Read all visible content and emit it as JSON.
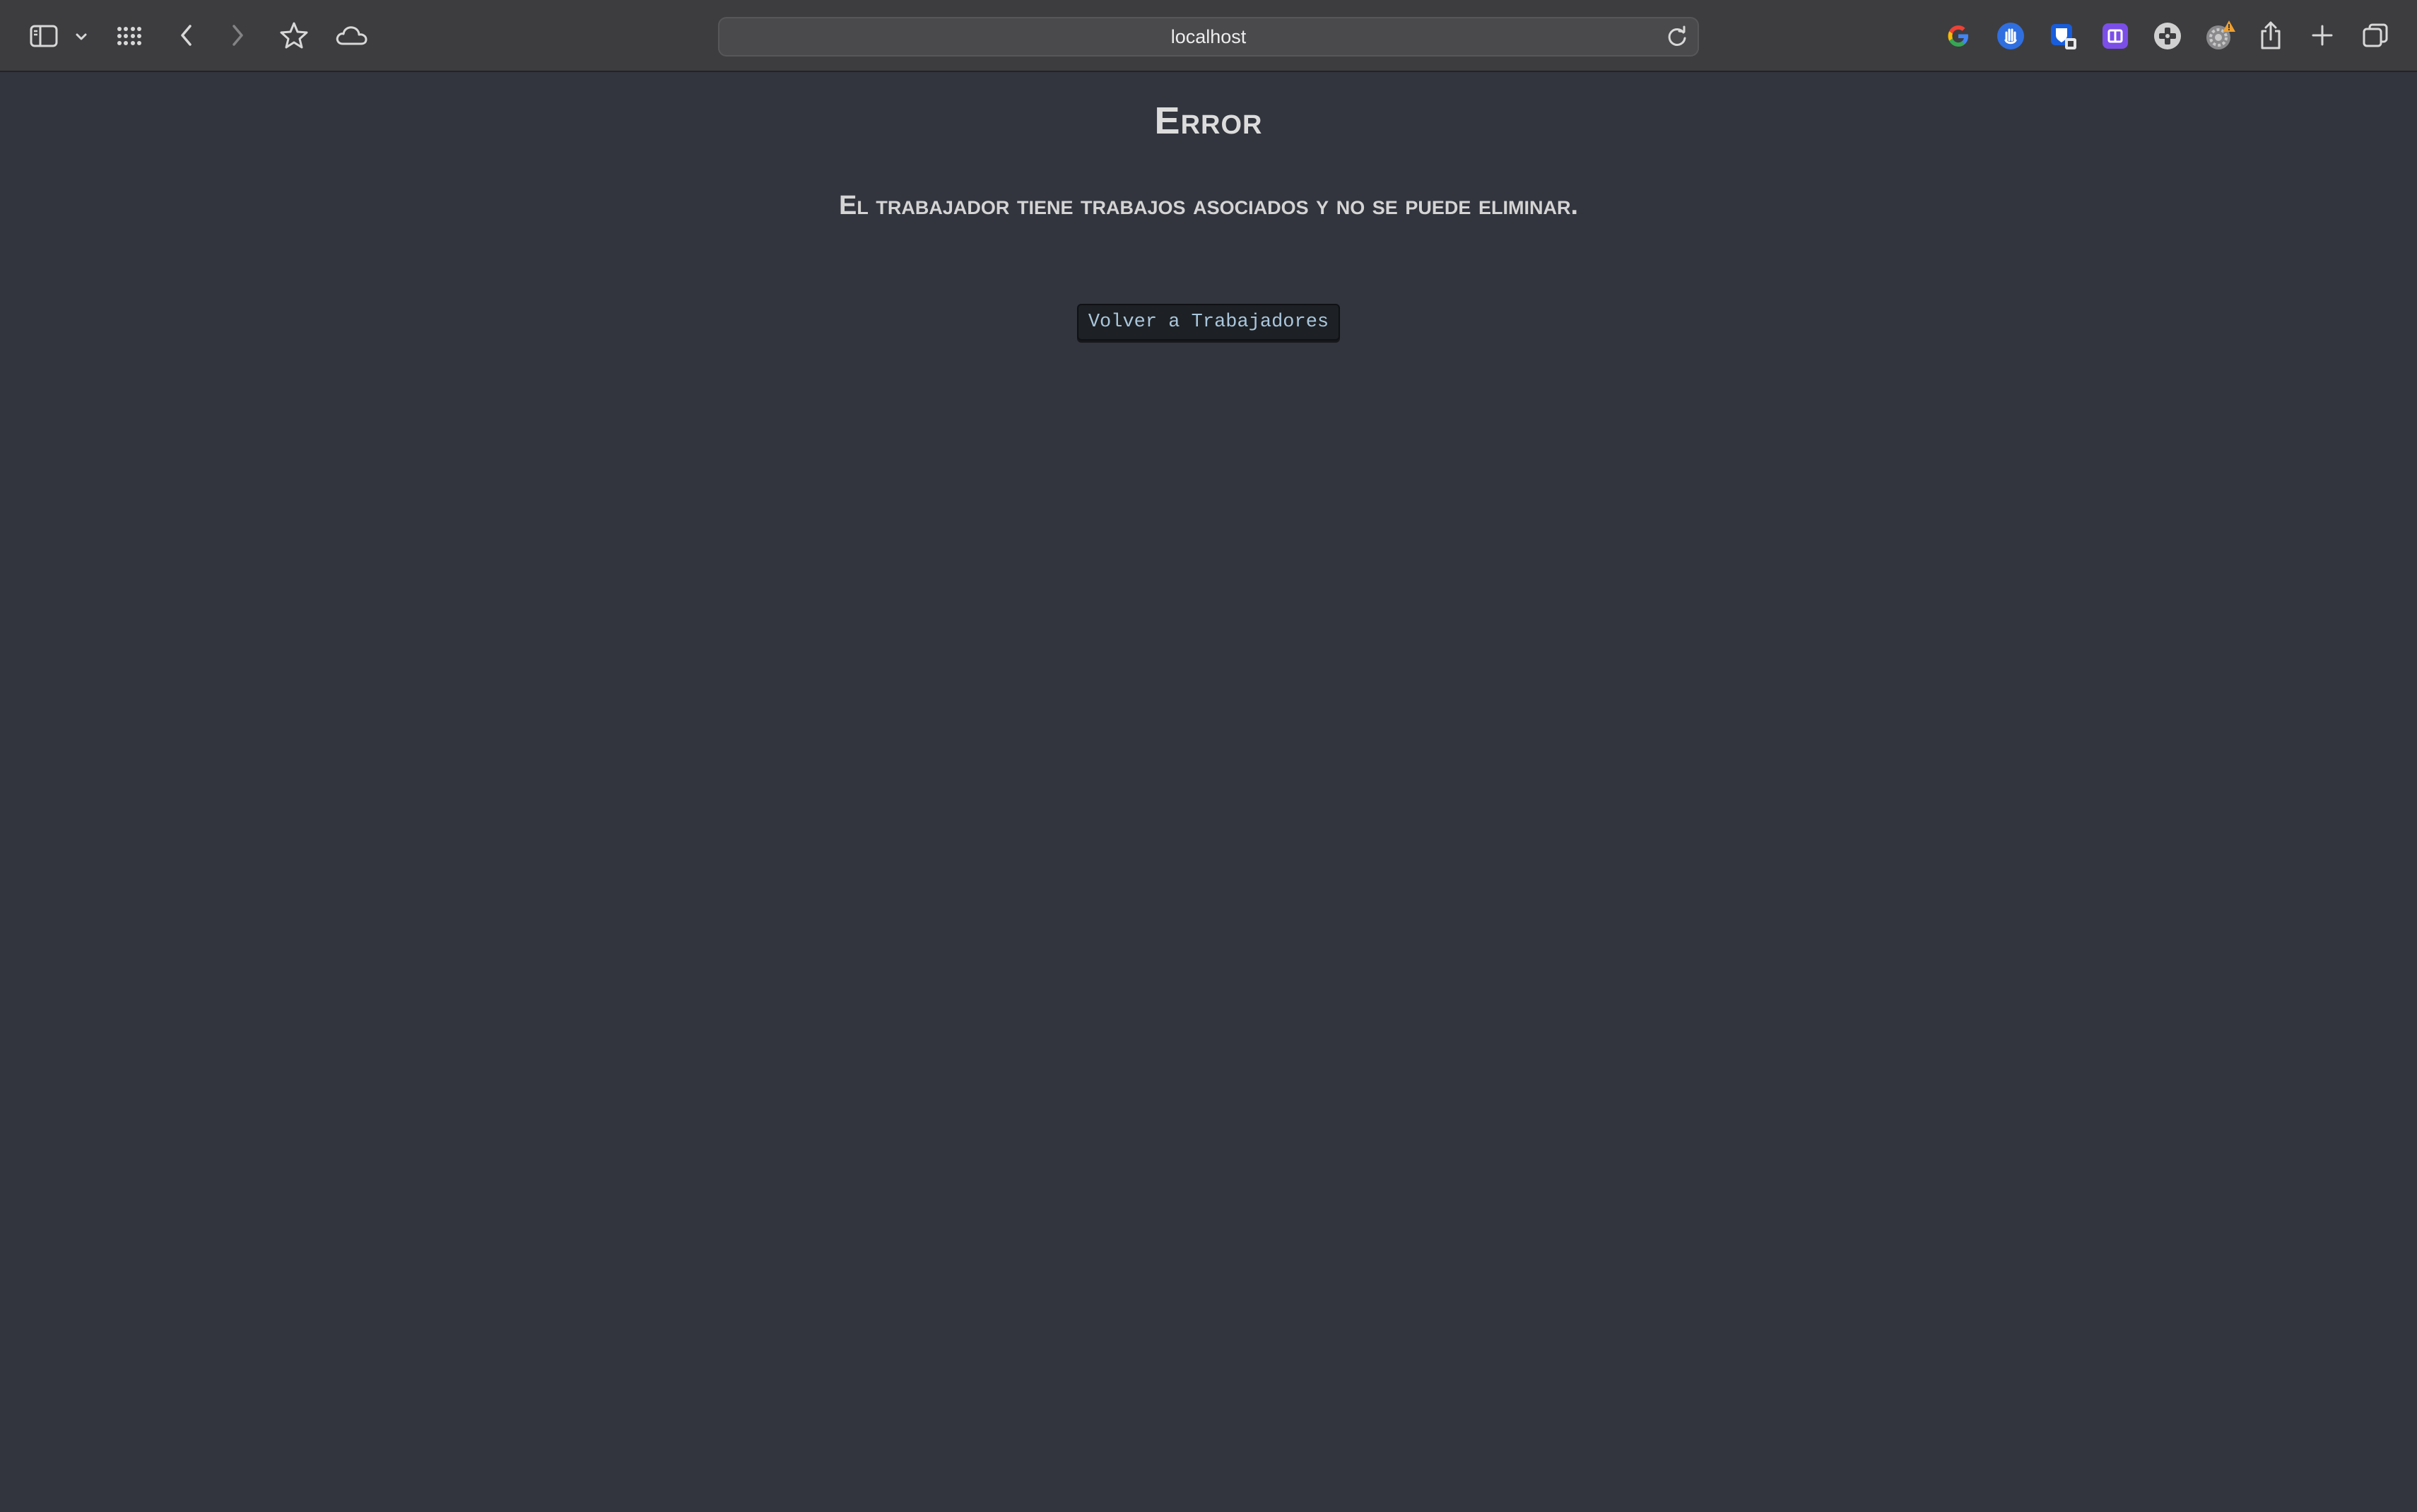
{
  "browser": {
    "url": "localhost",
    "toolbar_icons": {
      "sidebar": "sidebar-icon",
      "sidebar_menu": "chevron-down-icon",
      "tab_overview": "grid-icon",
      "back": "chevron-left-icon",
      "forward": "chevron-right-icon",
      "bookmark": "star-icon",
      "cloud": "cloud-icon",
      "reload": "reload-icon",
      "share": "share-icon",
      "new_tab": "plus-icon",
      "tabs": "tabs-icon"
    },
    "extensions": [
      "google-icon",
      "hand-shield-icon",
      "bitwarden-icon",
      "purple-app-icon",
      "gamepad-icon",
      "gear-warning-icon"
    ],
    "colors": {
      "toolbar": "#3d3d40",
      "page_background": "#32353e",
      "warning": "#f0a030"
    }
  },
  "page": {
    "title": "Error",
    "message": "El trabajador tiene trabajos asociados y no se puede eliminar.",
    "back_button_label": "Volver a Trabajadores"
  }
}
